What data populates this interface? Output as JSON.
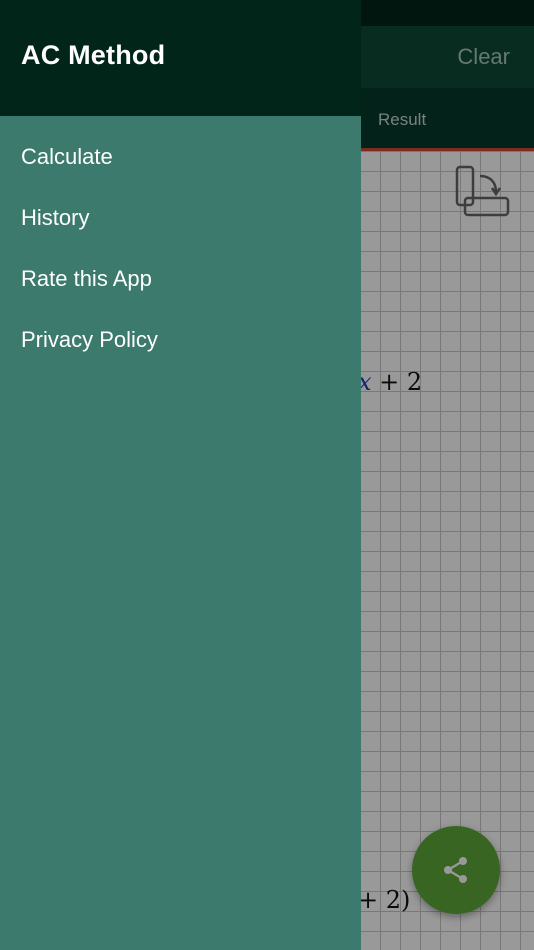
{
  "drawer": {
    "title": "AC Method",
    "menu": [
      {
        "label": "Calculate"
      },
      {
        "label": "History"
      },
      {
        "label": "Rate this App"
      },
      {
        "label": "Privacy Policy"
      }
    ]
  },
  "app": {
    "toolbar": {
      "clear_label": "Clear"
    },
    "tabs": {
      "result_label": "Result"
    },
    "math": {
      "line1_var": "x",
      "line1_rest": " + 2",
      "line2": "+ 2)"
    },
    "fab_icon": "share-icon"
  },
  "colors": {
    "drawer_header": "#012519",
    "drawer_body": "#3b7a6c",
    "fab": "#5fa83a",
    "tab_indicator": "#d04a3a"
  }
}
